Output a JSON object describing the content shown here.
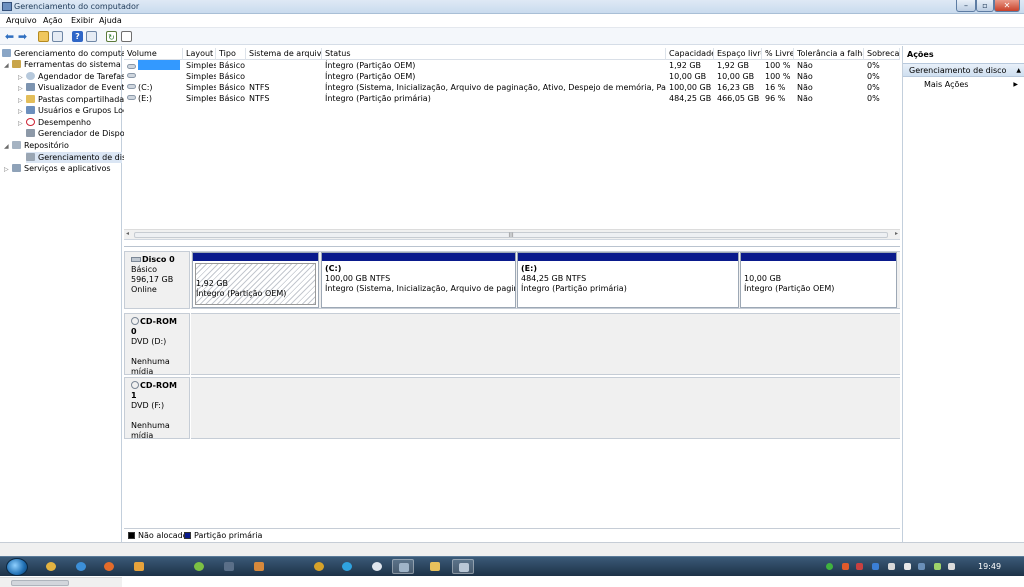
{
  "window": {
    "title": "Gerenciamento do computador",
    "controls": {
      "min": "–",
      "max": "▫",
      "close": "✕"
    }
  },
  "menu": [
    "Arquivo",
    "Ação",
    "Exibir",
    "Ajuda"
  ],
  "toolbar": [
    "back-icon",
    "forward-icon",
    "folder-up-icon",
    "properties-icon",
    "help-icon",
    "show-hide-icon",
    "refresh-icon",
    "export-icon"
  ],
  "tree": {
    "items": [
      {
        "label": "Gerenciamento do computad",
        "icon": "computer-icon",
        "expander": "",
        "selected": false
      },
      {
        "label": "Ferramentas do sistema",
        "icon": "tools-icon",
        "expander": "◢",
        "selected": false
      },
      {
        "label": "Agendador de Tarefas",
        "icon": "clock-icon",
        "expander": "▷",
        "selected": false
      },
      {
        "label": "Visualizador de Eventos",
        "icon": "event-viewer-icon",
        "expander": "▷",
        "selected": false
      },
      {
        "label": "Pastas compartilhadas",
        "icon": "shared-folder-icon",
        "expander": "▷",
        "selected": false
      },
      {
        "label": "Usuários e Grupos Loca",
        "icon": "users-icon",
        "expander": "▷",
        "selected": false
      },
      {
        "label": "Desempenho",
        "icon": "performance-icon",
        "expander": "▷",
        "selected": false
      },
      {
        "label": "Gerenciador de Disposit",
        "icon": "device-manager-icon",
        "expander": "",
        "selected": false
      },
      {
        "label": "Repositório",
        "icon": "storage-icon",
        "expander": "◢",
        "selected": false
      },
      {
        "label": "Gerenciamento de disco",
        "icon": "disk-icon",
        "expander": "",
        "selected": true
      },
      {
        "label": "Serviços e aplicativos",
        "icon": "services-icon",
        "expander": "▷",
        "selected": false
      }
    ]
  },
  "volumes": {
    "columns": [
      "Volume",
      "Layout",
      "Tipo",
      "Sistema de arquivos",
      "Status",
      "Capacidade",
      "Espaço livre",
      "% Livre",
      "Tolerância a falhas",
      "Sobrecarg"
    ],
    "rows": [
      [
        "",
        "Simples",
        "Básico",
        "",
        "Íntegro (Partição OEM)",
        "1,92 GB",
        "1,92 GB",
        "100 %",
        "Não",
        "0%"
      ],
      [
        "",
        "Simples",
        "Básico",
        "",
        "Íntegro (Partição OEM)",
        "10,00 GB",
        "10,00 GB",
        "100 %",
        "Não",
        "0%"
      ],
      [
        "(C:)",
        "Simples",
        "Básico",
        "NTFS",
        "Íntegro (Sistema, Inicialização, Arquivo de paginação, Ativo, Despejo de memória, Partição primária)",
        "100,00 GB",
        "16,23 GB",
        "16 %",
        "Não",
        "0%"
      ],
      [
        "(E:)",
        "Simples",
        "Básico",
        "NTFS",
        "Íntegro (Partição primária)",
        "484,25 GB",
        "466,05 GB",
        "96 %",
        "Não",
        "0%"
      ]
    ],
    "scroll_label": "III"
  },
  "disks": [
    {
      "name": "Disco 0",
      "type": "Básico",
      "size": "596,17 GB",
      "state": "Online",
      "partitions": [
        {
          "letter": "",
          "size": "1,92 GB",
          "status": "Íntegro (Partição OEM)",
          "hatched": true
        },
        {
          "letter": "(C:)",
          "size": "100,00 GB NTFS",
          "status": "Íntegro (Sistema, Inicialização, Arquivo de paginação, A",
          "hatched": false
        },
        {
          "letter": "(E:)",
          "size": "484,25 GB NTFS",
          "status": "Íntegro (Partição primária)",
          "hatched": false
        },
        {
          "letter": "",
          "size": "10,00 GB",
          "status": "Íntegro (Partição OEM)",
          "hatched": false
        }
      ]
    },
    {
      "name": "CD-ROM 0",
      "drive": "DVD (D:)",
      "media": "Nenhuma mídia"
    },
    {
      "name": "CD-ROM 1",
      "drive": "DVD (F:)",
      "media": "Nenhuma mídia"
    }
  ],
  "legend": [
    {
      "label": "Não alocado",
      "color": "#000000"
    },
    {
      "label": "Partição primária",
      "color": "#0a1a8c"
    }
  ],
  "actions": {
    "header": "Ações",
    "section": "Gerenciamento de disco",
    "more": "Mais Ações"
  },
  "taskbar": {
    "apps": [
      "chrome-icon",
      "ie-icon",
      "firefox-icon",
      "outlook-icon",
      "utorrent-icon",
      "network-icon",
      "media-icon",
      "winamp-icon",
      "skype-icon",
      "messenger-icon",
      "computer-mgmt-icon",
      "explorer-icon",
      "remote-icon"
    ],
    "clock": "19:49"
  }
}
